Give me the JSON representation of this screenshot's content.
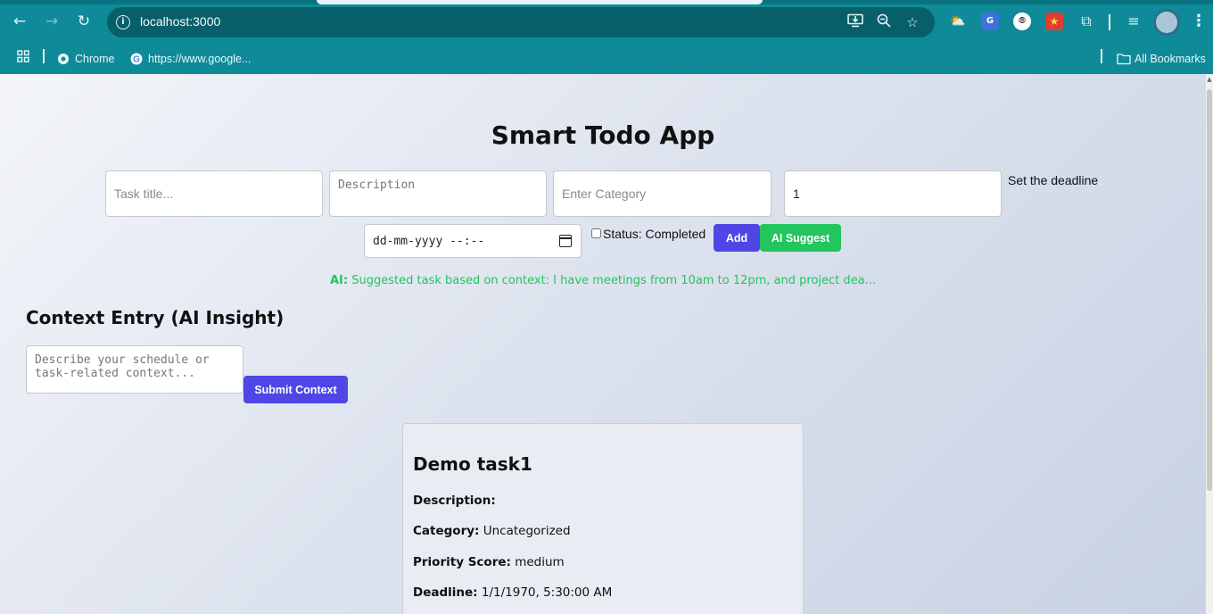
{
  "browser": {
    "url": "localhost:3000",
    "bookmarks": [
      {
        "label": "Chrome"
      },
      {
        "label": "https://www.google..."
      }
    ],
    "all_bookmarks_label": "All Bookmarks"
  },
  "app": {
    "title": "Smart Todo App",
    "form": {
      "title_placeholder": "Task title...",
      "description_placeholder": "Description",
      "category_placeholder": "Enter Category",
      "priority_value": "1",
      "deadline_label": "Set the deadline",
      "datetime_placeholder": "dd-mm-yyyy --:--",
      "status_label": "Status: Completed",
      "status_checked": false,
      "add_label": "Add",
      "ai_suggest_label": "AI Suggest"
    },
    "ai_suggestion": {
      "prefix": "AI:",
      "text": "Suggested task based on context: I have meetings from 10am to 12pm, and project dea..."
    },
    "context": {
      "heading": "Context Entry (AI Insight)",
      "placeholder": "Describe your schedule or task-related context...",
      "submit_label": "Submit Context"
    },
    "tasks": [
      {
        "title": "Demo task1",
        "description_label": "Description:",
        "description": "",
        "category_label": "Category:",
        "category": "Uncategorized",
        "priority_label": "Priority Score:",
        "priority": "medium",
        "deadline_label": "Deadline:",
        "deadline": "1/1/1970, 5:30:00 AM"
      }
    ]
  },
  "colors": {
    "chrome": "#0f8a98",
    "primary_button": "#4f46e5",
    "ai_button": "#22c55e",
    "ai_text": "#22c55e"
  },
  "icons": [
    "back-arrow-icon",
    "forward-arrow-icon",
    "reload-icon",
    "site-info-icon",
    "install-icon",
    "zoom-icon",
    "bookmark-star-icon",
    "weather-extension-icon",
    "translate-extension-icon",
    "extension-icon",
    "extensions-puzzle-icon",
    "media-control-icon",
    "profile-avatar",
    "menu-dots-icon",
    "apps-grid-icon",
    "folder-icon",
    "calendar-icon"
  ]
}
